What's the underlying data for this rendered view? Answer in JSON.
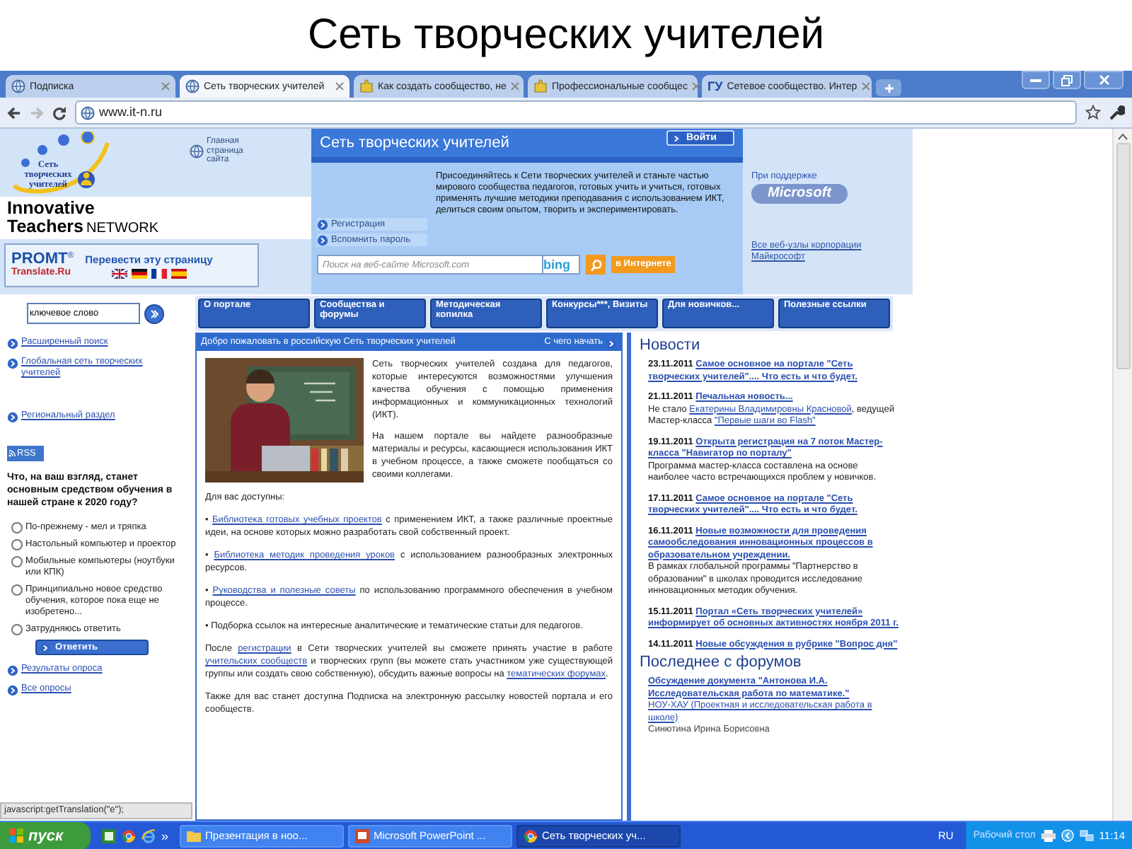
{
  "slide": {
    "title": "Сеть творческих учителей"
  },
  "browser": {
    "tabs": [
      {
        "label": "Подписка",
        "selected": false
      },
      {
        "label": "Сеть творческих учителей",
        "selected": true
      },
      {
        "label": "Как создать сообщество, не",
        "selected": false
      },
      {
        "label": "Профессиональные сообщес",
        "selected": false
      },
      {
        "label": "Сетевое сообщество. Интер",
        "selected": false,
        "icon_text": "ГУ"
      }
    ],
    "url": "www.it-n.ru"
  },
  "page": {
    "logo": [
      "Сеть",
      "творческих",
      "учителей"
    ],
    "home_link": "Главная страница сайта",
    "brand": {
      "line1": "Innovative",
      "line2": "Teachers",
      "suffix": "NETWORK"
    },
    "promt": {
      "name": "PROMT",
      "mark": "®",
      "site": "Translate.Ru",
      "action": "Перевести эту страницу"
    },
    "panel": {
      "title": "Сеть творческих учителей",
      "login": "Войти",
      "links": [
        "Регистрация",
        "Вспомнить пароль"
      ],
      "intro": "Присоединяйтесь к Сети творческих учителей и станьте частью мирового сообщества педагогов, готовых учить и учиться, готовых применять лучшие методики преподавания с использованием ИКТ, делиться своим опытом, творить и экспериментировать.",
      "search_placeholder": "Поиск на веб-сайте Microsoft.com",
      "search_brand": "bing",
      "web_button": "в Интернете"
    },
    "sponsor": {
      "label": "При поддержке",
      "logo": "Microsoft",
      "link": "Все веб-узлы корпорации Майкрософт"
    },
    "nav": {
      "search_value": "ключевое слово",
      "items": [
        "О портале",
        "Сообщества и форумы",
        "Методическая копилка",
        "Конкурсы***, Визиты",
        "Для новичков...",
        "Полезные ссылки"
      ]
    },
    "sidebar": {
      "links": [
        "Расширенный поиск",
        "Глобальная сеть творческих учителей",
        "Региональный раздел"
      ],
      "rss": "RSS",
      "poll": {
        "question": "Что, на ваш взгляд, станет основным средством обучения в нашей стране к 2020 году?",
        "options": [
          {
            "label": "По-прежнему - мел и тряпка",
            "selected": false
          },
          {
            "label": "Настольный компьютер и проектор",
            "selected": false
          },
          {
            "label": "Мобильные компьютеры (ноутбуки или КПК)",
            "selected": false
          },
          {
            "label": "Принципиально новое средство обучения, которое пока еще не изобретено...",
            "selected": false
          },
          {
            "label": "Затрудняюсь ответить",
            "selected": false
          }
        ],
        "submit": "Ответить"
      },
      "links_after": [
        "Результаты опроса",
        "Все опросы"
      ]
    },
    "welcome": {
      "title": "Добро пожаловать в российскую Сеть творческих учителей",
      "start_link": "С чего начать",
      "paragraphs": [
        "Сеть творческих учителей создана для педагогов, которые интересуются возможностями улучшения качества обучения с помощью применения информационных и коммуникационных технологий (ИКТ).",
        "На нашем портале вы найдете разнообразные материалы и ресурсы, касающиеся использования ИКТ в учебном процессе, а также сможете пообщаться со своими коллегами."
      ],
      "available_label": "Для вас доступны:",
      "bullets": [
        [
          {
            "text": "• ",
            "link": false
          },
          {
            "text": "Библиотека готовых учебных проектов",
            "link": true
          },
          {
            "text": " с применением ИКТ, а также различные проектные идеи, на основе которых можно разработать свой собственный проект.",
            "link": false
          }
        ],
        [
          {
            "text": "• ",
            "link": false
          },
          {
            "text": "Библиотека методик проведения уроков",
            "link": true
          },
          {
            "text": " с использованием разнообразных электронных ресурсов.",
            "link": false
          }
        ],
        [
          {
            "text": "• ",
            "link": false
          },
          {
            "text": "Руководства и полезные советы",
            "link": true
          },
          {
            "text": " по использованию программного обеспечения в учебном процессе.",
            "link": false
          }
        ],
        [
          {
            "text": "• Подборка ссылок на интересные аналитические и тематические статьи для педагогов.",
            "link": false
          }
        ]
      ],
      "closing": [
        [
          {
            "text": "После ",
            "link": false
          },
          {
            "text": "регистрации",
            "link": true
          },
          {
            "text": " в Сети творческих учителей вы сможете принять участие в работе ",
            "link": false
          },
          {
            "text": "учительских сообществ",
            "link": true
          },
          {
            "text": " и творческих групп (вы можете стать участником уже существующей группы или создать свою собственную), обсудить важные вопросы на ",
            "link": false
          },
          {
            "text": "тематических форумах",
            "link": true
          },
          {
            "text": ".",
            "link": false
          }
        ],
        [
          {
            "text": "Также для вас станет доступна Подписка на электронную рассылку новостей портала и его сообществ.",
            "link": false
          }
        ]
      ]
    },
    "news": {
      "title": "Новости",
      "items": [
        {
          "date": "23.11.2011",
          "title": "Самое основное на портале \"Сеть творческих учителей\".... Что есть и что будет."
        },
        {
          "date": "21.11.2011",
          "title": "Печальная новость...",
          "text": [
            {
              "text": "Не стало ",
              "link": false
            },
            {
              "text": "Екатерины Владимировны Красновой",
              "link": true
            },
            {
              "text": ", ведущей Мастер-класса ",
              "link": false
            },
            {
              "text": "\"Первые шаги во Flash\"",
              "link": true
            }
          ]
        },
        {
          "date": "19.11.2011",
          "title": "Открыта регистрация на 7 поток Мастер-класса \"Навигатор по порталу\"",
          "text": [
            {
              "text": "Программа мастер-класса составлена на основе наиболее часто встречающихся проблем у новичков.",
              "link": false
            }
          ]
        },
        {
          "date": "17.11.2011",
          "title": "Самое основное на портале \"Сеть творческих учителей\".... Что есть и что будет."
        },
        {
          "date": "16.11.2011",
          "title": "Новые возможности для проведения самообследования инновационных процессов в образовательном учреждении.",
          "text": [
            {
              "text": "В рамках глобальной программы \"Партнерство в образовании\" в школах проводится исследование инновационных методик обучения.",
              "link": false
            }
          ]
        },
        {
          "date": "15.11.2011",
          "title": "Портал «Сеть творческих учителей» информирует об основных активностях ноября 2011 г."
        },
        {
          "date": "14.11.2011",
          "title": "Новые обсуждения в рубрике \"Вопрос дня\""
        }
      ]
    },
    "forums": {
      "title": "Последнее с форумов",
      "items": [
        {
          "title": "Обсуждение документа \"Антонова И.А. Исследовательская работа по математике.\"",
          "section": "НОУ-ХАУ (Проектная и исследовательская работа в школе)",
          "author": "Синютина Ирина Борисовна"
        }
      ]
    }
  },
  "status_text": "javascript:getTranslation(\"e\");",
  "taskbar": {
    "start": "пуск",
    "more": "»",
    "tasks": [
      {
        "label": "Презентация в ноо...",
        "selected": false
      },
      {
        "label": "Microsoft PowerPoint ...",
        "selected": false
      },
      {
        "label": "Сеть творческих уч...",
        "selected": true
      }
    ],
    "language": "RU",
    "desktop": "Рабочий стол",
    "clock": "11:14"
  }
}
